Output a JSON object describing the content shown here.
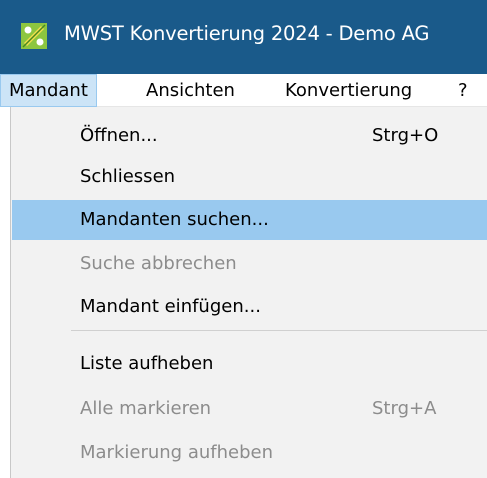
{
  "window": {
    "title": "MWST Konvertierung 2024 - Demo AG",
    "icon": "app-logo-icon",
    "titlebar_color": "#1a5a8a"
  },
  "menubar": {
    "items": [
      {
        "label": "Mandant",
        "active": true
      },
      {
        "label": "Ansichten",
        "active": false
      },
      {
        "label": "Konvertierung",
        "active": false
      },
      {
        "label": "?",
        "active": false
      }
    ]
  },
  "dropdown": {
    "items": [
      {
        "label": "Öffnen...",
        "shortcut": "Strg+O",
        "enabled": true,
        "highlighted": false
      },
      {
        "label": "Schliessen",
        "shortcut": "",
        "enabled": true,
        "highlighted": false
      },
      {
        "label": "Mandanten suchen...",
        "shortcut": "",
        "enabled": true,
        "highlighted": true
      },
      {
        "label": "Suche abbrechen",
        "shortcut": "",
        "enabled": false,
        "highlighted": false
      },
      {
        "label": "Mandant einfügen...",
        "shortcut": "",
        "enabled": true,
        "highlighted": false
      },
      {
        "label": "Liste aufheben",
        "shortcut": "",
        "enabled": true,
        "highlighted": false
      },
      {
        "label": "Alle markieren",
        "shortcut": "Strg+A",
        "enabled": false,
        "highlighted": false
      },
      {
        "label": "Markierung aufheben",
        "shortcut": "",
        "enabled": false,
        "highlighted": false
      }
    ],
    "highlight_color": "#99c9ef"
  }
}
